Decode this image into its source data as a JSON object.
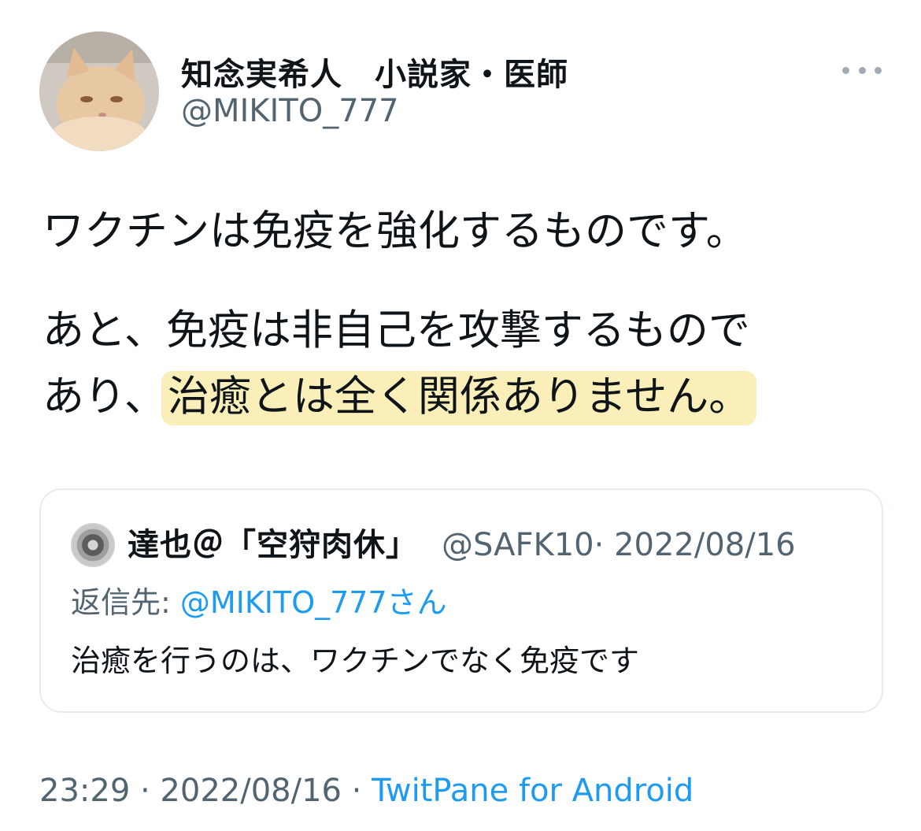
{
  "author": {
    "display_name": "知念実希人　小説家・医師",
    "handle": "@MIKITO_777",
    "avatar_icon": "cat-avatar-icon"
  },
  "more_icon": "more-dots-icon",
  "tweet": {
    "paragraph1": "ワクチンは免疫を強化するものです。",
    "paragraph2_line1": "あと、免疫は非自己を攻撃するもので",
    "paragraph2_line2_prefix": "あり、",
    "paragraph2_line2_highlight": "治癒とは全く関係ありません。",
    "highlight_color": "#fbefb9"
  },
  "quote": {
    "avatar_icon": "coin-avatar-icon",
    "display_name": "達也＠「空狩肉休」",
    "handle": "@SAFK10",
    "date": "· 2022/08/16",
    "reply_prefix": "返信先: ",
    "reply_target": "@MIKITO_777さん",
    "text": "治癒を行うのは、ワクチンでなく免疫です"
  },
  "footer": {
    "time_and_date": "23:29 · 2022/08/16 · ",
    "client": "TwitPane for Android"
  },
  "colors": {
    "text_primary": "#0f1419",
    "text_secondary": "#536471",
    "link": "#1d9bf0",
    "border": "#e6ecf0"
  }
}
